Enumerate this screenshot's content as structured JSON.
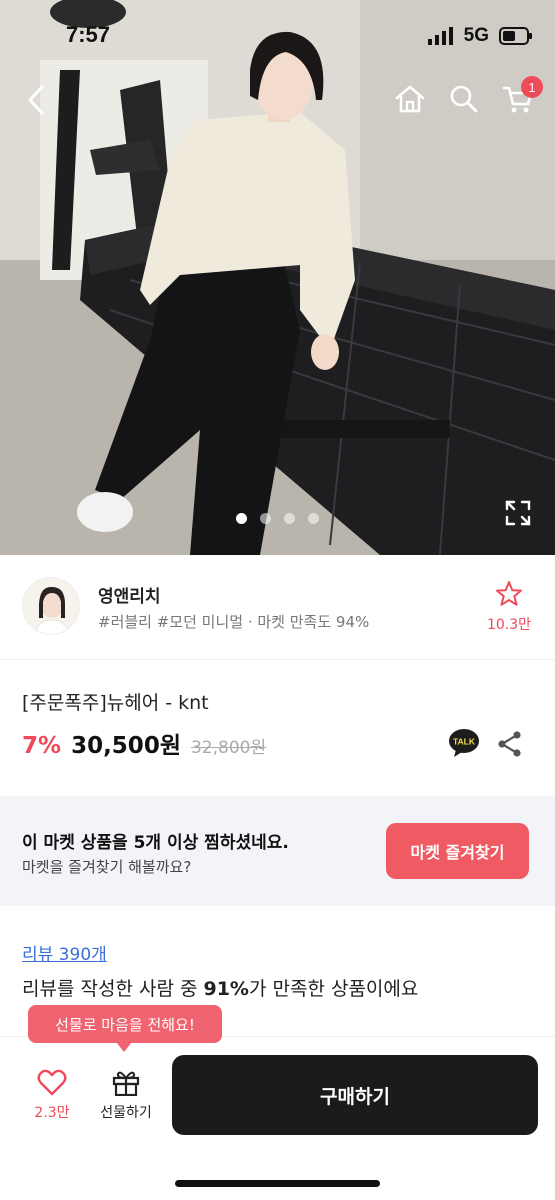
{
  "status": {
    "time": "7:57",
    "network": "5G"
  },
  "header": {
    "cart_count": "1"
  },
  "gallery": {
    "total": 4,
    "active_index": 0
  },
  "shop": {
    "name": "영앤리치",
    "meta": "#러블리 #모던 미니멀 · 마켓 만족도 94%",
    "favorite_count": "10.3만"
  },
  "product": {
    "title": "[주문폭주]뉴헤어 - knt",
    "discount": "7%",
    "price": "30,500원",
    "original_price": "32,800원",
    "talk_label": "TALK"
  },
  "banner": {
    "title": "이 마켓 상품을 5개 이상 찜하셨네요.",
    "subtitle": "마켓을 즐겨찾기 해볼까요?",
    "button_label": "마켓 즐겨찾기"
  },
  "review": {
    "link_label": "리뷰 390개",
    "text_prefix": "리뷰를 작성한 사람 중 ",
    "text_highlight": "91%",
    "text_suffix": "가 만족한 상품이에요"
  },
  "bottom": {
    "tooltip": "선물로 마음을 전해요!",
    "like_count": "2.3만",
    "gift_label": "선물하기",
    "buy_label": "구매하기"
  },
  "colors": {
    "accent": "#ef4a5a",
    "link": "#3a6fd8",
    "buy_button": "#1b1b1b",
    "banner_bg": "#f2f4f7"
  }
}
